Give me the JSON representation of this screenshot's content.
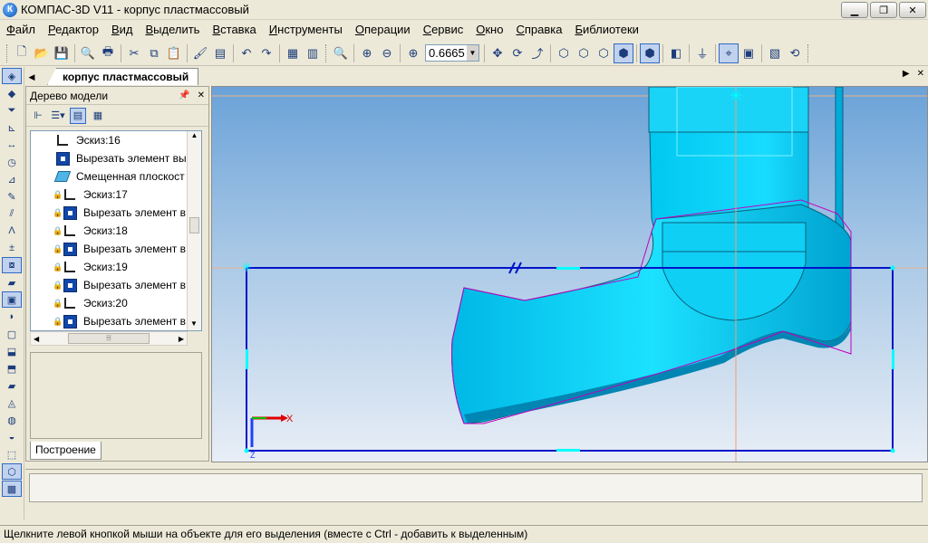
{
  "window": {
    "title": "КОМПАС-3D V11 - корпус пластмассовый",
    "app_icon": "К"
  },
  "menu": [
    "Файл",
    "Редактор",
    "Вид",
    "Выделить",
    "Вставка",
    "Инструменты",
    "Операции",
    "Сервис",
    "Окно",
    "Справка",
    "Библиотеки"
  ],
  "toolbar": {
    "zoom_value": "0.6665"
  },
  "document_tab": {
    "label": "корпус пластмассовый"
  },
  "tree": {
    "title": "Дерево модели",
    "items": [
      {
        "label": "Эскиз:16",
        "icon": "sketch-icon",
        "locked": false
      },
      {
        "label": "Вырезать элемент вы",
        "icon": "cut-extrude-icon",
        "locked": false
      },
      {
        "label": "Смещенная плоскост",
        "icon": "offset-plane-icon",
        "locked": false
      },
      {
        "label": "Эскиз:17",
        "icon": "sketch-icon",
        "locked": true
      },
      {
        "label": "Вырезать элемент в",
        "icon": "cut-extrude-icon",
        "locked": true
      },
      {
        "label": "Эскиз:18",
        "icon": "sketch-icon",
        "locked": true
      },
      {
        "label": "Вырезать элемент в",
        "icon": "cut-extrude-icon",
        "locked": true
      },
      {
        "label": "Эскиз:19",
        "icon": "sketch-icon",
        "locked": true
      },
      {
        "label": "Вырезать элемент в",
        "icon": "cut-extrude-icon",
        "locked": true
      },
      {
        "label": "Эскиз:20",
        "icon": "sketch-icon",
        "locked": true
      },
      {
        "label": "Вырезать элемент в",
        "icon": "cut-extrude-icon",
        "locked": true
      }
    ],
    "bottom_tab": "Построение"
  },
  "viewport": {
    "axis_x_label": "X",
    "axis_z_label": "Z"
  },
  "status": {
    "text": "Щелкните левой кнопкой мыши на объекте для его выделения (вместе с Ctrl - добавить к выделенным)"
  }
}
